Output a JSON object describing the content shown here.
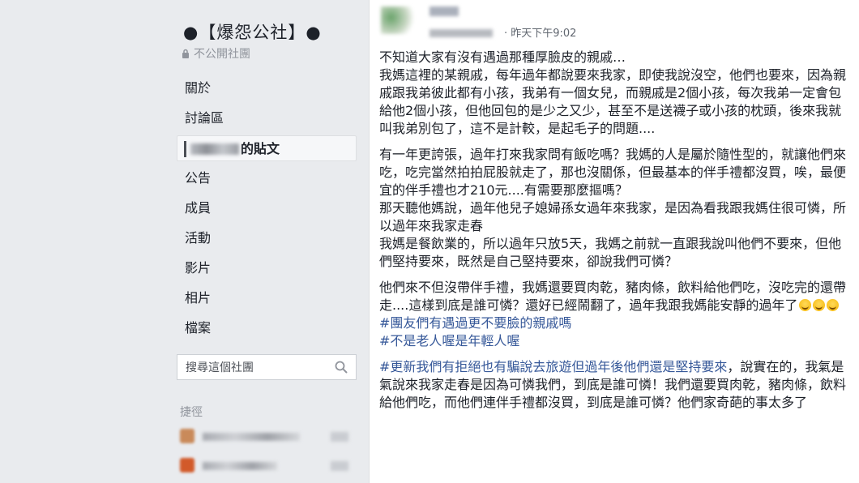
{
  "sidebar": {
    "group_title": "●【爆怨公社】●",
    "privacy": "不公開社團",
    "nav": {
      "about": "關於",
      "discussion": "討論區",
      "my_posts_suffix": "的貼文",
      "announcements": "公告",
      "members": "成員",
      "events": "活動",
      "videos": "影片",
      "photos": "相片",
      "files": "檔案"
    },
    "search_placeholder": "搜尋這個社團",
    "shortcuts_label": "捷徑"
  },
  "post": {
    "timestamp": "· 昨天下午9:02",
    "paragraphs": [
      "不知道大家有沒有遇過那種厚臉皮的親戚…",
      "我媽這裡的某親戚，每年過年都說要來我家，即使我說沒空，他們也要來，因為親戚跟我弟彼此都有小孩，我弟有一個女兒，而親戚是2個小孩，每次我弟一定會包給他2個小孩，但他回包的是少之又少，甚至不是送襪子或小孩的枕頭，後來我就叫我弟別包了，這不是計較，是起毛子的問題....",
      "有一年更誇張，過年打來我家問有飯吃嗎？我媽的人是屬於隨性型的，就讓他們來吃，吃完當然拍拍屁股就走了，那也沒關係，但最基本的伴手禮都沒買，唉，最便宜的伴手禮也才210元....有需要那麼摳嗎？\n那天聽他媽說，過年他兒子媳婦孫女過年來我家，是因為看我跟我媽住很可憐，所以過年來我家走春\n我媽是餐飲業的，所以過年只放5天，我媽之前就一直跟我說叫他們不要來，但他們堅持要來，既然是自己堅持要來，卻說我們可憐？",
      "他們來不但沒帶伴手禮，我媽還要買肉乾，豬肉條，飲料給他們吃，沒吃完的還帶走....這樣到底是誰可憐？還好已經鬧翻了，過年我跟我媽能安靜的過年了"
    ],
    "hashtag_lines": [
      "#團友們有遇過更不要臉的親戚嗎",
      "#不是老人喔是年輕人喔"
    ],
    "update_hashtag": "#更新我們有拒絕也有騙說去旅遊但過年後他們還是堅持要來",
    "update_text": "，說實在的，我氣是氣說來我家走春是因為可憐我們，到底是誰可憐！我們還要買肉乾，豬肉條，飲料給他們吃，而他們連伴手禮都沒買，到底是誰可憐？他們家奇葩的事太多了"
  }
}
